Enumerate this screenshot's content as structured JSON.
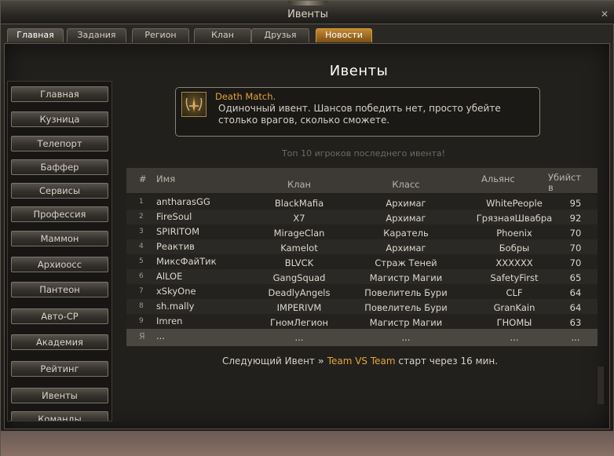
{
  "window": {
    "title": "Ивенты"
  },
  "tabs": [
    {
      "label": "Главная"
    },
    {
      "label": "Задания"
    },
    {
      "label": "Регион"
    },
    {
      "label": "Клан"
    },
    {
      "label": "Друзья"
    },
    {
      "label": "Новости"
    }
  ],
  "sidebar": {
    "items": [
      {
        "label": "Главная"
      },
      {
        "label": "Кузница"
      },
      {
        "label": "Телепорт"
      },
      {
        "label": "Баффер"
      },
      {
        "label": "Сервисы"
      },
      {
        "label": "Профессия"
      },
      {
        "label": "Маммон"
      },
      {
        "label": "Архиоосс"
      },
      {
        "label": "Пантеон"
      },
      {
        "label": "Авто-СР"
      },
      {
        "label": "Академия"
      },
      {
        "label": "Рейтинг"
      },
      {
        "label": "Ивенты"
      },
      {
        "label": "Команды"
      }
    ]
  },
  "main": {
    "title": "Ивенты",
    "event": {
      "name": "Death Match.",
      "description": "Одиночный ивент. Шансов победить нет, просто убейте столько врагов, сколько сможете.",
      "icon": "sword-icon"
    },
    "top_caption": "Топ 10 игроков последнего ивента!",
    "table": {
      "headers": {
        "num": "#",
        "name": "Имя",
        "clan": "Клан",
        "class": "Класс",
        "ally": "Альянс",
        "kills": "Убийств"
      },
      "rows": [
        {
          "num": "1",
          "name": "antharasGG",
          "clan": "BlackMafia",
          "class": "Архимаг",
          "ally": "WhitePeople",
          "kills": "95"
        },
        {
          "num": "2",
          "name": "FireSoul",
          "clan": "X7",
          "class": "Архимаг",
          "ally": "ГрязнаяШвабра",
          "kills": "92"
        },
        {
          "num": "3",
          "name": "SPIRITOM",
          "clan": "MirageClan",
          "class": "Каратель",
          "ally": "Phoenix",
          "kills": "70"
        },
        {
          "num": "4",
          "name": "Реактив",
          "clan": "Kamelot",
          "class": "Архимаг",
          "ally": "Бобры",
          "kills": "70"
        },
        {
          "num": "5",
          "name": "МиксФайТик",
          "clan": "BLVCK",
          "class": "Страж Теней",
          "ally": "XXXXXX",
          "kills": "70"
        },
        {
          "num": "6",
          "name": "AlLOE",
          "clan": "GangSquad",
          "class": "Магистр Магии",
          "ally": "SafetyFirst",
          "kills": "65"
        },
        {
          "num": "7",
          "name": "xSkyOne",
          "clan": "DeadlyAngels",
          "class": "Повелитель Бури",
          "ally": "CLF",
          "kills": "64"
        },
        {
          "num": "8",
          "name": "sh.mally",
          "clan": "IMPERIVM",
          "class": "Повелитель Бури",
          "ally": "GranKain",
          "kills": "64"
        },
        {
          "num": "9",
          "name": "Imren",
          "clan": "ГномЛегион",
          "class": "Магистр Магии",
          "ally": "ГНОМЫ",
          "kills": "63"
        }
      ],
      "me_row": {
        "num": "Я",
        "name": "...",
        "clan": "...",
        "class": "...",
        "ally": "...",
        "kills": "..."
      }
    },
    "next_event": {
      "prefix": "Следующий Ивент",
      "arrows": "»",
      "event_name": "Team VS Team",
      "suffix": "старт через 16 мин."
    }
  }
}
